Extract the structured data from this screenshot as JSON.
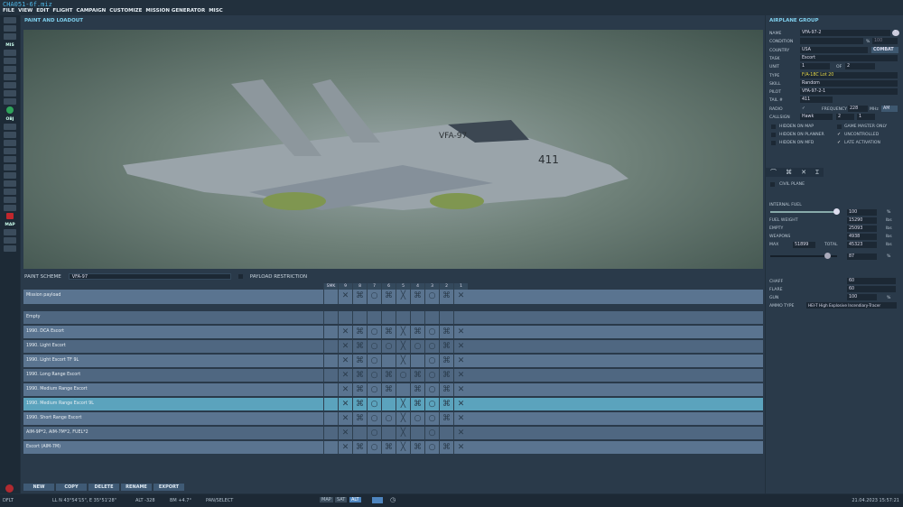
{
  "title": "CHA051-6f.miz",
  "menu": [
    "FILE",
    "VIEW",
    "EDIT",
    "FLIGHT",
    "CAMPAIGN",
    "CUSTOMIZE",
    "MISSION GENERATOR",
    "MISC"
  ],
  "toolbar": {
    "mis": "MIS",
    "obj": "OBJ",
    "map": "MAP"
  },
  "panel_title": "PAINT AND LOADOUT",
  "aircraft_label": "VFA-97",
  "tail_number_painted": "411",
  "paint_scheme_label": "PAINT SCHEME",
  "paint_scheme_value": "VFA-97",
  "payload_restriction": "PAYLOAD RESTRICTION",
  "pylons": [
    "SMK",
    "9",
    "8",
    "7",
    "6",
    "5",
    "4",
    "3",
    "2",
    "1"
  ],
  "payload_rows": [
    {
      "name": "Mission payload",
      "cells": [
        "",
        "x",
        "b",
        "o",
        "b",
        "X",
        "b",
        "o",
        "b",
        "x"
      ]
    },
    {
      "name": "Empty",
      "cells": [
        "",
        "",
        "",
        "",
        "",
        "",
        "",
        "",
        "",
        ""
      ]
    },
    {
      "name": "1990. DCA Escort",
      "cells": [
        "",
        "x",
        "b",
        "o",
        "b",
        "X",
        "b",
        "o",
        "b",
        "x"
      ]
    },
    {
      "name": "1990. Light Escort",
      "cells": [
        "",
        "x",
        "b",
        "o",
        "o",
        "X",
        "o",
        "o",
        "b",
        "x"
      ]
    },
    {
      "name": "1990. Light Escort TF 9L",
      "cells": [
        "",
        "x",
        "b",
        "o",
        "",
        "X",
        "",
        "o",
        "b",
        "x"
      ]
    },
    {
      "name": "1990. Long Range Escort",
      "cells": [
        "",
        "x",
        "b",
        "o",
        "b",
        "o",
        "b",
        "o",
        "b",
        "x"
      ]
    },
    {
      "name": "1990. Medium Range Escort",
      "cells": [
        "",
        "x",
        "b",
        "o",
        "b",
        "",
        "b",
        "o",
        "b",
        "x"
      ]
    },
    {
      "name": "1990. Medium Range Escort 9L",
      "cells": [
        "",
        "x",
        "b",
        "o",
        "",
        "X",
        "b",
        "o",
        "b",
        "x"
      ]
    },
    {
      "name": "1990. Short Range Escort",
      "cells": [
        "",
        "x",
        "b",
        "o",
        "o",
        "X",
        "o",
        "o",
        "b",
        "x"
      ]
    },
    {
      "name": "AIM-9P*2, AIM-7M*2, FUEL*2",
      "cells": [
        "",
        "x",
        "",
        "o",
        "",
        "X",
        "",
        "o",
        "",
        "x"
      ]
    },
    {
      "name": "Escort (AIM-7M)",
      "cells": [
        "",
        "x",
        "b",
        "o",
        "b",
        "X",
        "b",
        "o",
        "b",
        "x"
      ]
    }
  ],
  "selected_row": 7,
  "buttons": [
    "NEW",
    "COPY",
    "DELETE",
    "RENAME",
    "EXPORT"
  ],
  "group": {
    "title": "AIRPLANE GROUP",
    "help": "?",
    "name_label": "NAME",
    "name": "VFA-97-2",
    "condition_label": "CONDITION",
    "condition_unit": "%",
    "condition_value": "100",
    "country_label": "COUNTRY",
    "country": "USA",
    "combat": "COMBAT",
    "task_label": "TASK",
    "task": "Escort",
    "unit_label": "UNIT",
    "unit": "1",
    "of": "OF",
    "unit_total": "2",
    "type_label": "TYPE",
    "type": "F/A-18C Lot 20",
    "skill_label": "SKILL",
    "skill": "Random",
    "pilot_label": "PILOT",
    "pilot": "VFA-97-2-1",
    "tail_label": "TAIL #",
    "tail": "411",
    "radio_label": "RADIO",
    "freq_label": "FREQUENCY",
    "freq": "228",
    "freq_unit": "MHz",
    "band": "AM",
    "callsign_label": "CALLSIGN",
    "callsign": "Hawk",
    "cs1": "2",
    "cs2": "1",
    "hidden_map": "HIDDEN ON MAP",
    "hidden_planner": "HIDDEN ON PLANNER",
    "hidden_mfd": "HIDDEN ON MFD",
    "gm_only": "GAME MASTER ONLY",
    "uncontrolled": "UNCONTROLLED",
    "late": "LATE ACTIVATION"
  },
  "fuel": {
    "civil": "CIVIL PLANE",
    "internal_label": "INTERNAL FUEL",
    "internal": "100",
    "internal_fraction": 1.0,
    "pct": "%",
    "weight_label": "FUEL WEIGHT",
    "weight": "15290",
    "empty_label": "EMPTY",
    "empty": "25093",
    "weapons_label": "WEAPONS",
    "weapons": "4938",
    "max_label": "MAX",
    "max": "51899",
    "total_label": "TOTAL",
    "total": "45323",
    "total_pct": "87",
    "total_fraction": 0.87,
    "lbs": "lbs",
    "chaff_label": "CHAFF",
    "chaff": "60",
    "flare_label": "FLARE",
    "flare": "60",
    "gun_label": "GUN",
    "gun": "100",
    "ammo_label": "AMMO TYPE",
    "ammo": "HEI-T High Explosive Incendiary-Tracer"
  },
  "status": {
    "dflt": "DFLT",
    "ll": "LL  N 43°54'15\", E 35°51'28\"",
    "alt": "ALT  -328",
    "bm": "BM  +4.7°",
    "mode": "PAN/SELECT",
    "map": "MAP",
    "sat": "SAT",
    "alt_btn": "ALT",
    "datetime": "21.04.2023 15:57:21"
  }
}
